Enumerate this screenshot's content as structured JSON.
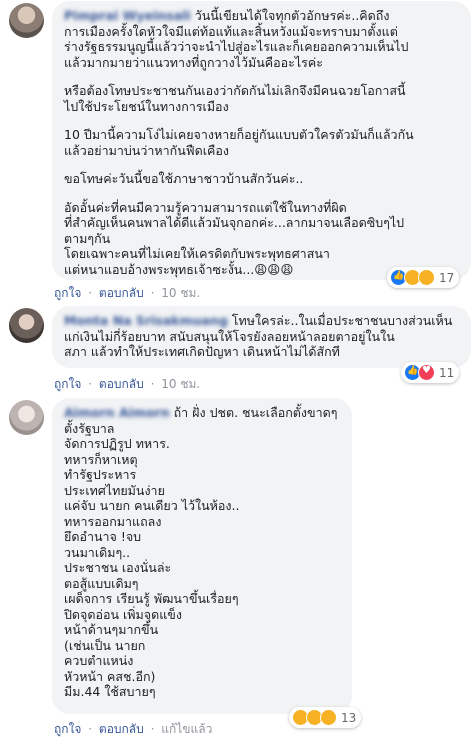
{
  "comments": [
    {
      "author": "Pimprai Wyeinsali",
      "lines": [
        "วันนี้เขียนได้ใจทุกตัวอักษรค่ะ..คิดถึง",
        "การเมืองครั้งใดหัวใจมีแต่ท้อแท้และสิ้นหวังแม้จะทราบมาตั้งแต่",
        "ร่างรัฐธรรมนูญนี้แล้วว่าจะนำไปสู่อะไรและก็เคยออกความเห็นไป",
        "แล้วมากมายว่าแนวทางที่ถูกวางไว้มันคืออะไรค่ะ",
        "",
        "หรือต้องโทษประชาชนกันเองว่ากัดกันไม่เลิกจึงมีคนฉวยโอกาสนี้",
        "ไปใช้ประโยชน์ในทางการเมือง",
        "",
        "10 ปีมานี้ความโง่ไม่เคยจางหายก็อยู่กันแบบตัวใครตัวมันก็แล้วกัน",
        "แล้วอย่ามาบ่นว่าหากันฟืดเคือง",
        "",
        "ขอโทษค่ะวันนี้ขอใช้ภาษาชาวบ้านสักวันค่ะ..",
        "",
        "อัดอั้นค่ะที่คนมีความรู้ความสามารถแต่ใช้ในทางที่ผิด",
        "ที่สำคัญเห็นคนพาลได้ดีแล้วมันจุกอกค่ะ...ลากมาจนเลือดซิบๆไป",
        "ตามๆกัน",
        "โดยเฉพาะคนที่ไม่เคยให้เครดิตกับพระพุทธศาสนา",
        "แต่หนาแอบอ้างพระพุทธเจ้าซะงั้น...😩😩😩"
      ],
      "reaction_count": "17",
      "like": "ถูกใจ",
      "reply": "ตอบกลับ",
      "time": "10 ชม."
    },
    {
      "author": "Monta Na Srisakmuang",
      "lines": [
        "โทษใครล่ะ..ในเมื่อประชาชนบางส่วนเห็น",
        "แก่เงินไม่กี่ร้อยบาท สนับสนุนให้โจรยังลอยหน้าลอยตาอยู่ในใน",
        "สภา แล้วทำให้ประเทศเกิดปัญหา เดินหน้าไม่ได้สักที"
      ],
      "reaction_count": "11",
      "like": "ถูกใจ",
      "reply": "ตอบกลับ",
      "time": "10 ชม."
    },
    {
      "author": "Aimorn Aimorn",
      "lines": [
        "ถ้า ฝั่ง ปชต. ชนะเลือกตั้งขาดๆ",
        "ตั้งรัฐบาล",
        "จัดการปฏิรูป ทหาร.",
        "ทหารก็หาเหตุ",
        "ทำรัฐประหาร",
        "ประเทศไทยมันง่าย",
        "แค่จับ นายก คนเดียว ไว้ในห้อง..",
        "ทหารออกมาแถลง",
        "ยึดอำนาจ !จบ",
        "วนมาเดิมๆ..",
        "ประชาชน เองนั่นล่ะ",
        "ตอสู้แบบเดิมๆ",
        "เผด็จการ เรียนรู้ พัฒนาขึ้นเรื่อยๆ",
        "ปิดจุดอ่อน เพิ่มจุดแข็ง",
        "หน้าด้านๆมากขึ้น",
        "(เช่นเป็น นายก",
        "ควบตำแหน่ง",
        "หัวหน้า คสช.อีก)",
        "มีม.44 ใช้สบายๆ"
      ],
      "reaction_count": "13",
      "like": "ถูกใจ",
      "reply": "ตอบกลับ",
      "edited": "แก้ไขแล้ว",
      "time": "10 ชม."
    }
  ],
  "colors": {
    "link": "#385898",
    "bubble": "#f2f3f5",
    "meta": "#90949c"
  }
}
